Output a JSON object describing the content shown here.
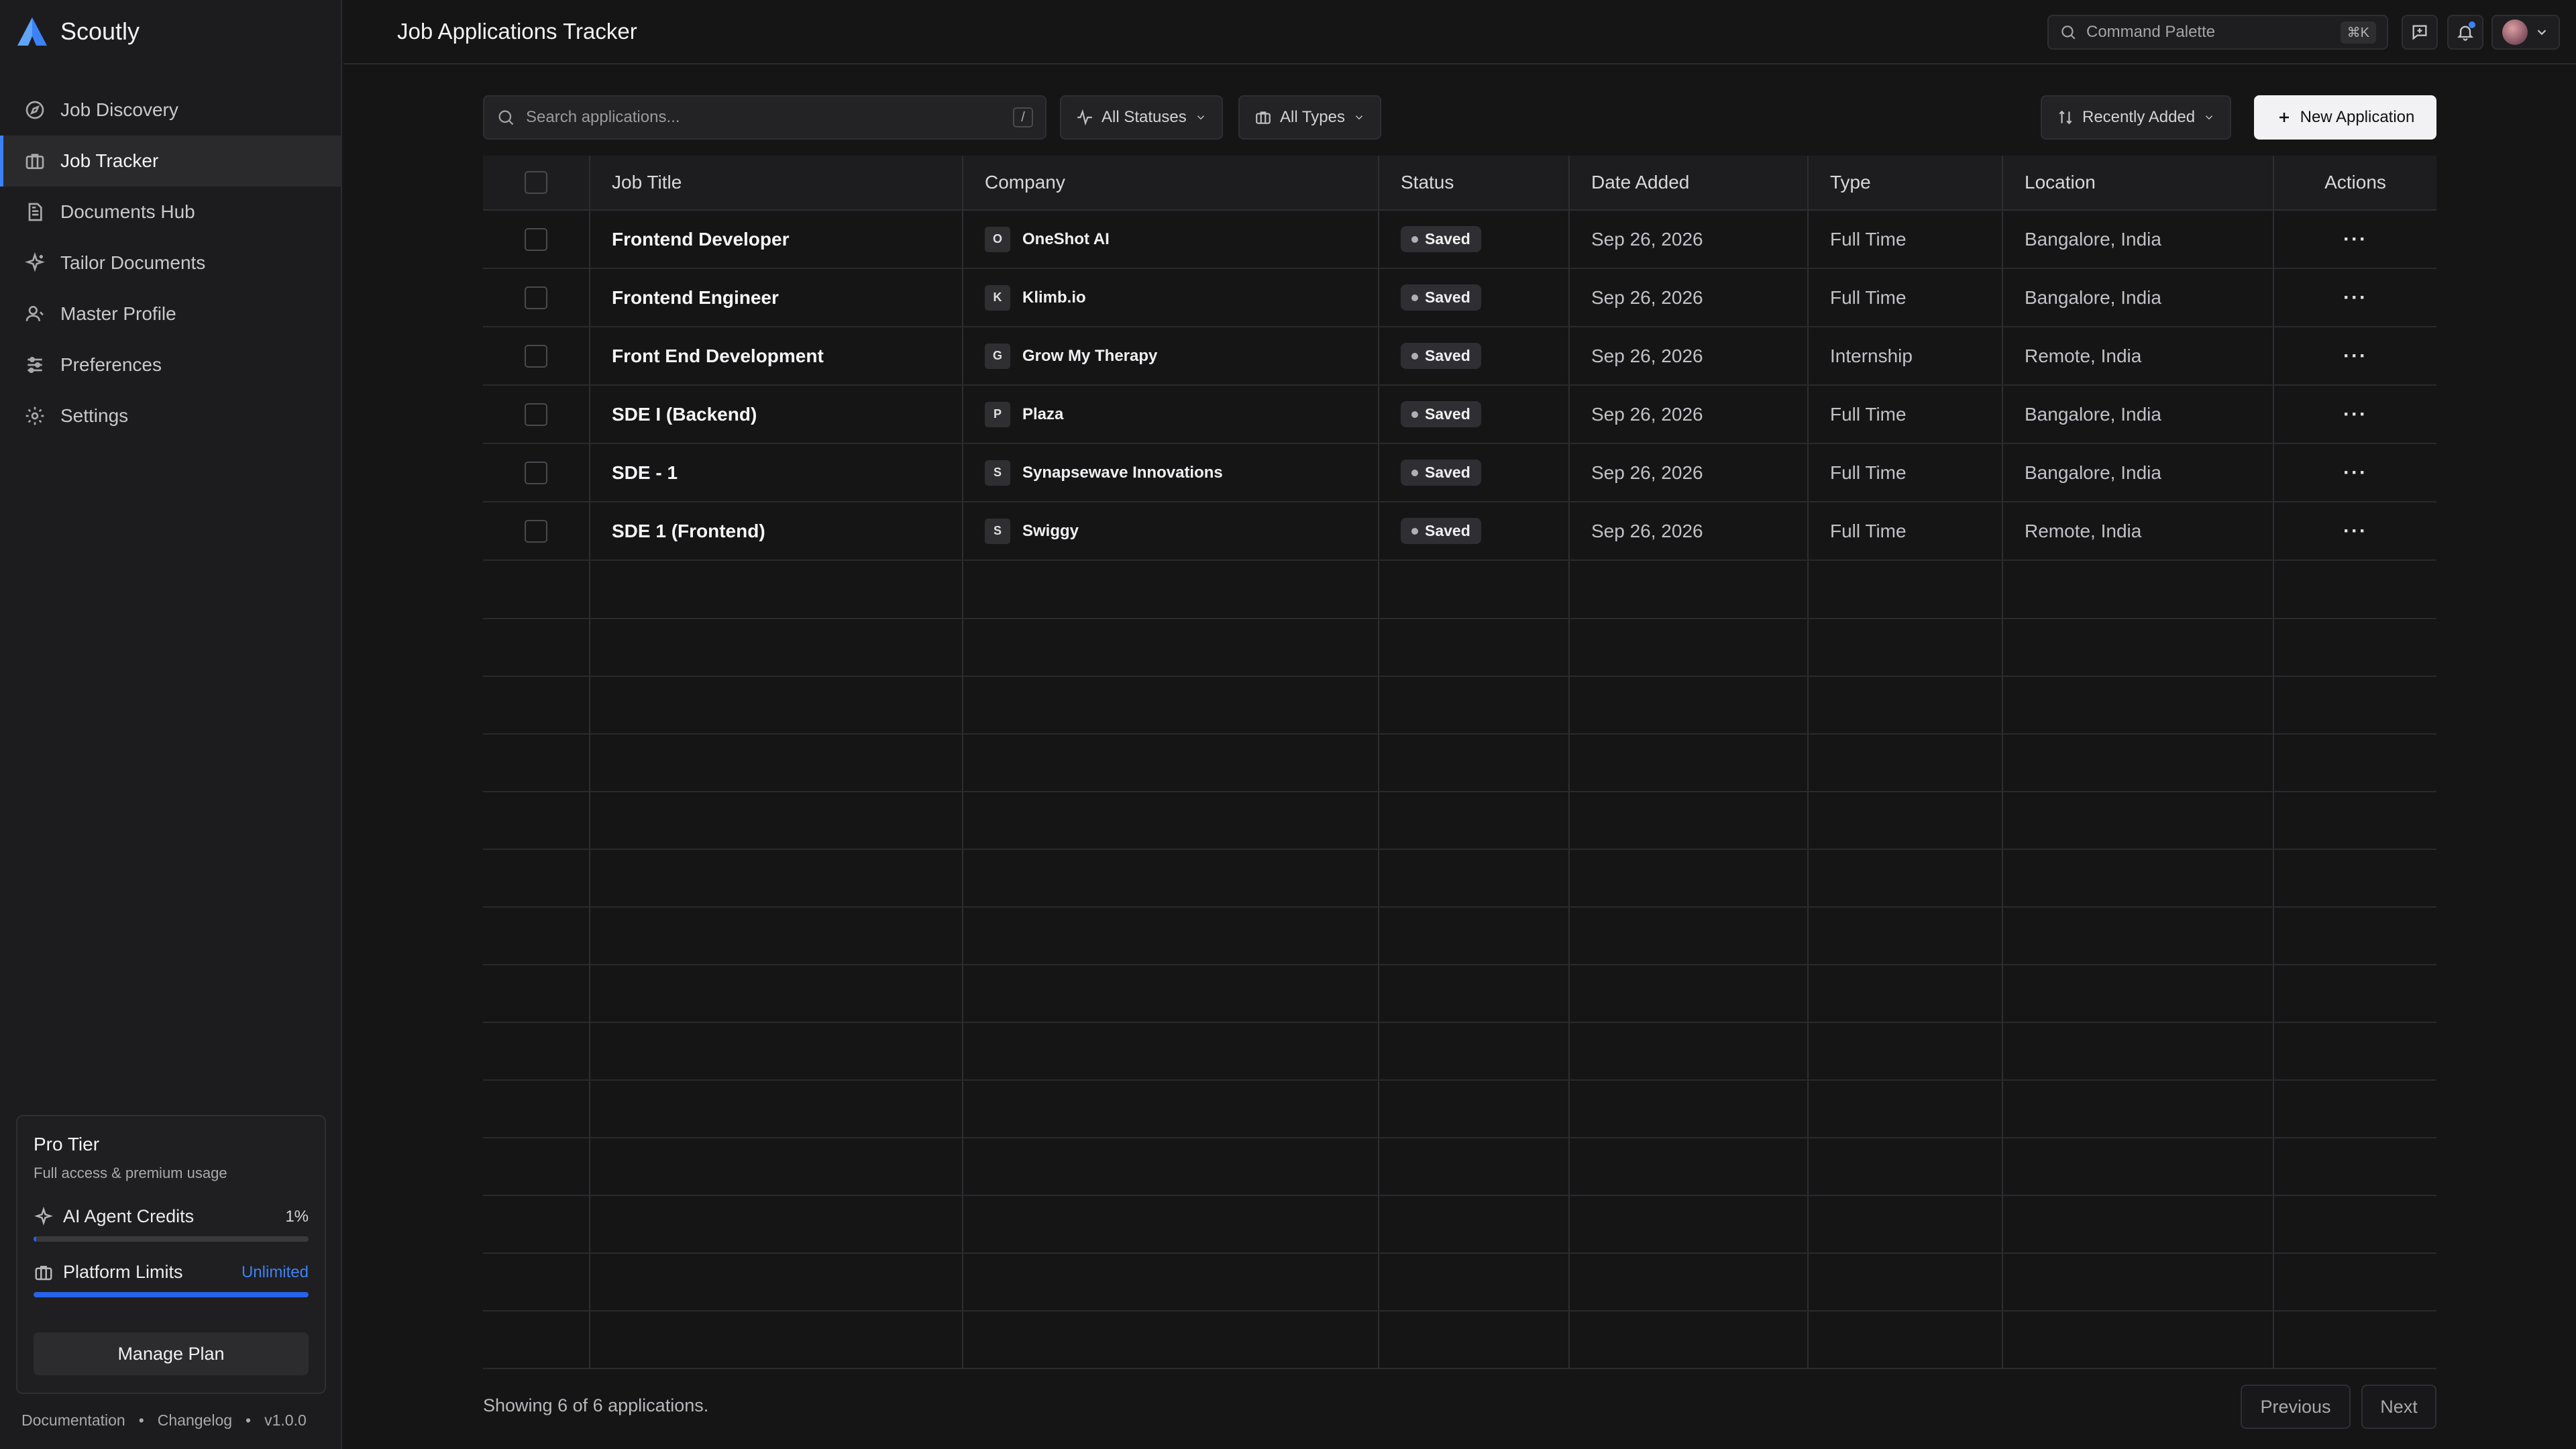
{
  "app": {
    "name": "Scoutly",
    "version": "v1.0.0"
  },
  "sidebar": {
    "items": [
      {
        "label": "Job Discovery",
        "icon": "compass-icon",
        "active": false
      },
      {
        "label": "Job Tracker",
        "icon": "briefcase-icon",
        "active": true
      },
      {
        "label": "Documents Hub",
        "icon": "document-icon",
        "active": false
      },
      {
        "label": "Tailor Documents",
        "icon": "sparkle-icon",
        "active": false
      },
      {
        "label": "Master Profile",
        "icon": "user-icon",
        "active": false
      },
      {
        "label": "Preferences",
        "icon": "sliders-icon",
        "active": false
      },
      {
        "label": "Settings",
        "icon": "gear-icon",
        "active": false
      }
    ],
    "plan": {
      "title": "Pro Tier",
      "subtitle": "Full access & premium usage",
      "credits_label": "AI Agent Credits",
      "credits_percent": "1%",
      "credits_fraction": 0.01,
      "limits_label": "Platform Limits",
      "limits_value": "Unlimited",
      "limits_fraction": 1.0,
      "manage_label": "Manage Plan"
    },
    "footer": {
      "documentation": "Documentation",
      "changelog": "Changelog",
      "separator": "•"
    }
  },
  "header": {
    "title": "Job Applications Tracker",
    "command_palette": "Command Palette",
    "command_shortcut": "⌘K"
  },
  "toolbar": {
    "search_placeholder": "Search applications...",
    "search_shortcut": "/",
    "status_filter": "All Statuses",
    "type_filter": "All Types",
    "sort": "Recently Added",
    "new_button": "New Application"
  },
  "table": {
    "columns": [
      "Job Title",
      "Company",
      "Status",
      "Date Added",
      "Type",
      "Location",
      "Actions"
    ],
    "rows": [
      {
        "title": "Frontend Developer",
        "company": "OneShot AI",
        "initial": "O",
        "status": "Saved",
        "date": "Sep 26, 2026",
        "type": "Full Time",
        "location": "Bangalore, India"
      },
      {
        "title": "Frontend Engineer",
        "company": "Klimb.io",
        "initial": "K",
        "status": "Saved",
        "date": "Sep 26, 2026",
        "type": "Full Time",
        "location": "Bangalore, India"
      },
      {
        "title": "Front End Development",
        "company": "Grow My Therapy",
        "initial": "G",
        "status": "Saved",
        "date": "Sep 26, 2026",
        "type": "Internship",
        "location": "Remote, India"
      },
      {
        "title": "SDE I (Backend)",
        "company": "Plaza",
        "initial": "P",
        "status": "Saved",
        "date": "Sep 26, 2026",
        "type": "Full Time",
        "location": "Bangalore, India"
      },
      {
        "title": "SDE - 1",
        "company": "Synapsewave Innovations",
        "initial": "S",
        "status": "Saved",
        "date": "Sep 26, 2026",
        "type": "Full Time",
        "location": "Bangalore, India"
      },
      {
        "title": "SDE 1 (Frontend)",
        "company": "Swiggy",
        "initial": "S",
        "status": "Saved",
        "date": "Sep 26, 2026",
        "type": "Full Time",
        "location": "Remote, India"
      }
    ],
    "actions_glyph": "···"
  },
  "footer": {
    "showing": "Showing 6 of 6 applications.",
    "previous": "Previous",
    "next": "Next"
  },
  "colors": {
    "accent": "#3b82f6",
    "background": "#151516",
    "sidebar": "#1c1c1e"
  }
}
